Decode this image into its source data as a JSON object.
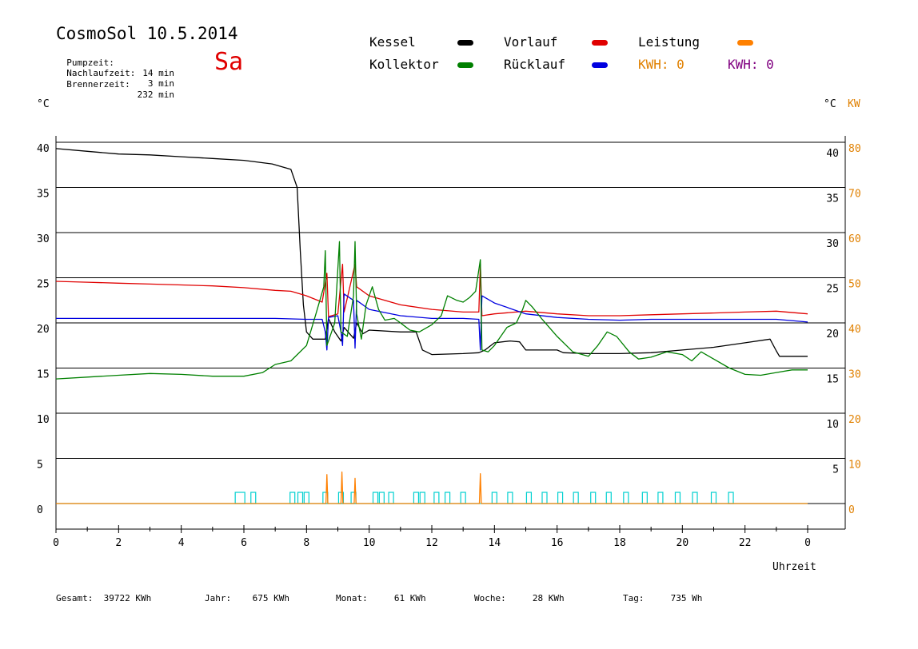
{
  "header": {
    "title": "CosmoSol 10.5.2014",
    "weekday": "Sa",
    "info": [
      {
        "label": "Pumpzeit:",
        "value": "14 min"
      },
      {
        "label": "Nachlaufzeit:",
        "value": "3 min"
      },
      {
        "label": "Brennerzeit:",
        "value": "232 min"
      }
    ]
  },
  "legend": {
    "items": [
      {
        "label": "Kessel",
        "color": "#000000"
      },
      {
        "label": "Kollektor",
        "color": "#008000"
      },
      {
        "label": "Vorlauf",
        "color": "#e00000"
      },
      {
        "label": "Rücklauf",
        "color": "#0000e0"
      },
      {
        "label": "Leistung",
        "color": "#ff8000"
      }
    ],
    "kwh": [
      {
        "text": "KWH: 0",
        "color": "#e08000"
      },
      {
        "text": "KWH: 0",
        "color": "#800080"
      }
    ]
  },
  "units": {
    "left": "°C",
    "right_c": "°C",
    "right_kw": "KW"
  },
  "footer": {
    "stats": [
      {
        "label": "Gesamt:",
        "value": "39722 KWh"
      },
      {
        "label": "Jahr:",
        "value": "675 KWh"
      },
      {
        "label": "Monat:",
        "value": "61 KWh"
      },
      {
        "label": "Woche:",
        "value": "28 KWh"
      },
      {
        "label": "Tag:",
        "value": "735 Wh"
      }
    ]
  },
  "chart_data": {
    "type": "line",
    "xlabel": "Uhrzeit",
    "x_ticks": [
      "0",
      "2",
      "4",
      "6",
      "8",
      "10",
      "12",
      "14",
      "16",
      "18",
      "20",
      "22",
      "0"
    ],
    "xlim": [
      0,
      24
    ],
    "y_left_ticks": [
      "0",
      "5",
      "10",
      "15",
      "20",
      "25",
      "30",
      "35",
      "40"
    ],
    "y_right_c_ticks": [
      "5",
      "10",
      "15",
      "20",
      "25",
      "30",
      "35",
      "40"
    ],
    "y_right_kw_ticks": [
      "0",
      "10",
      "20",
      "30",
      "40",
      "50",
      "60",
      "70",
      "80"
    ],
    "ylim": [
      0,
      40
    ],
    "grid": true,
    "series": [
      {
        "name": "Kessel",
        "color": "#000000",
        "points": [
          [
            0,
            39.3
          ],
          [
            1,
            39.0
          ],
          [
            2,
            38.7
          ],
          [
            3,
            38.6
          ],
          [
            4,
            38.4
          ],
          [
            5,
            38.2
          ],
          [
            6,
            38.0
          ],
          [
            6.9,
            37.6
          ],
          [
            7.2,
            37.3
          ],
          [
            7.5,
            37.0
          ],
          [
            7.7,
            35.0
          ],
          [
            7.8,
            28.0
          ],
          [
            7.9,
            22.0
          ],
          [
            8.0,
            19.0
          ],
          [
            8.2,
            18.2
          ],
          [
            8.6,
            18.2
          ],
          [
            8.7,
            20.5
          ],
          [
            8.9,
            19.0
          ],
          [
            9.1,
            18.0
          ],
          [
            9.2,
            19.5
          ],
          [
            9.5,
            18.3
          ],
          [
            9.6,
            20.0
          ],
          [
            9.8,
            18.8
          ],
          [
            10.0,
            19.2
          ],
          [
            11.0,
            19.0
          ],
          [
            11.5,
            19.0
          ],
          [
            11.7,
            17.0
          ],
          [
            12.0,
            16.5
          ],
          [
            13.0,
            16.6
          ],
          [
            13.5,
            16.7
          ],
          [
            13.7,
            17.0
          ],
          [
            14.0,
            17.8
          ],
          [
            14.5,
            18.0
          ],
          [
            14.8,
            17.9
          ],
          [
            15.0,
            17.0
          ],
          [
            16.0,
            17.0
          ],
          [
            16.2,
            16.7
          ],
          [
            17.0,
            16.6
          ],
          [
            18.0,
            16.6
          ],
          [
            19.0,
            16.7
          ],
          [
            20.0,
            17.0
          ],
          [
            21.0,
            17.3
          ],
          [
            22.0,
            17.8
          ],
          [
            22.8,
            18.2
          ],
          [
            23.0,
            16.9
          ],
          [
            23.1,
            16.3
          ],
          [
            24.0,
            16.3
          ]
        ]
      },
      {
        "name": "Vorlauf",
        "color": "#e00000",
        "points": [
          [
            0,
            24.6
          ],
          [
            1,
            24.5
          ],
          [
            2,
            24.4
          ],
          [
            3,
            24.3
          ],
          [
            4,
            24.2
          ],
          [
            5,
            24.1
          ],
          [
            6,
            23.9
          ],
          [
            7,
            23.6
          ],
          [
            7.5,
            23.5
          ],
          [
            8.0,
            23.0
          ],
          [
            8.5,
            22.3
          ],
          [
            8.65,
            25.5
          ],
          [
            8.7,
            20.7
          ],
          [
            9.0,
            21.0
          ],
          [
            9.15,
            26.5
          ],
          [
            9.2,
            21.2
          ],
          [
            9.55,
            26.5
          ],
          [
            9.6,
            24.0
          ],
          [
            10.0,
            23.0
          ],
          [
            11.0,
            22.0
          ],
          [
            12.0,
            21.5
          ],
          [
            13.0,
            21.2
          ],
          [
            13.5,
            21.2
          ],
          [
            13.55,
            26.5
          ],
          [
            13.6,
            20.8
          ],
          [
            14.0,
            21.0
          ],
          [
            15.0,
            21.3
          ],
          [
            16.0,
            21.0
          ],
          [
            17.0,
            20.8
          ],
          [
            18.0,
            20.8
          ],
          [
            19.0,
            20.9
          ],
          [
            20.0,
            21.0
          ],
          [
            21.0,
            21.1
          ],
          [
            22.0,
            21.2
          ],
          [
            23.0,
            21.3
          ],
          [
            24.0,
            21.0
          ]
        ]
      },
      {
        "name": "Rücklauf",
        "color": "#0000e0",
        "points": [
          [
            0,
            20.5
          ],
          [
            1,
            20.5
          ],
          [
            2,
            20.5
          ],
          [
            3,
            20.5
          ],
          [
            4,
            20.5
          ],
          [
            5,
            20.5
          ],
          [
            6,
            20.5
          ],
          [
            7,
            20.5
          ],
          [
            8,
            20.4
          ],
          [
            8.5,
            20.4
          ],
          [
            8.6,
            19.0
          ],
          [
            8.65,
            17.0
          ],
          [
            8.7,
            20.6
          ],
          [
            9.0,
            20.8
          ],
          [
            9.1,
            19.0
          ],
          [
            9.15,
            17.5
          ],
          [
            9.2,
            23.2
          ],
          [
            9.5,
            22.5
          ],
          [
            9.55,
            17.2
          ],
          [
            9.6,
            22.5
          ],
          [
            10.0,
            21.5
          ],
          [
            11.0,
            20.8
          ],
          [
            12.0,
            20.5
          ],
          [
            13.0,
            20.5
          ],
          [
            13.5,
            20.4
          ],
          [
            13.55,
            17.0
          ],
          [
            13.6,
            23.0
          ],
          [
            14.0,
            22.2
          ],
          [
            15.0,
            21.0
          ],
          [
            16.0,
            20.6
          ],
          [
            17.0,
            20.4
          ],
          [
            18.0,
            20.3
          ],
          [
            19.0,
            20.4
          ],
          [
            20.0,
            20.4
          ],
          [
            21.0,
            20.4
          ],
          [
            22.0,
            20.4
          ],
          [
            23.0,
            20.4
          ],
          [
            24.0,
            20.1
          ]
        ]
      },
      {
        "name": "Kollektor",
        "color": "#008000",
        "points": [
          [
            0,
            13.8
          ],
          [
            1,
            14.0
          ],
          [
            2,
            14.2
          ],
          [
            3,
            14.4
          ],
          [
            4,
            14.3
          ],
          [
            5,
            14.1
          ],
          [
            6,
            14.1
          ],
          [
            6.6,
            14.5
          ],
          [
            7.0,
            15.4
          ],
          [
            7.5,
            15.8
          ],
          [
            8.0,
            17.5
          ],
          [
            8.3,
            21.0
          ],
          [
            8.55,
            24.0
          ],
          [
            8.6,
            28.0
          ],
          [
            8.65,
            17.5
          ],
          [
            8.9,
            20.0
          ],
          [
            9.0,
            26.0
          ],
          [
            9.05,
            29.0
          ],
          [
            9.1,
            19.0
          ],
          [
            9.3,
            18.5
          ],
          [
            9.5,
            23.0
          ],
          [
            9.55,
            29.0
          ],
          [
            9.6,
            21.0
          ],
          [
            9.75,
            18.2
          ],
          [
            9.9,
            22.0
          ],
          [
            10.1,
            24.0
          ],
          [
            10.3,
            21.5
          ],
          [
            10.5,
            20.3
          ],
          [
            10.8,
            20.5
          ],
          [
            11.0,
            20.0
          ],
          [
            11.3,
            19.2
          ],
          [
            11.6,
            19.0
          ],
          [
            12.0,
            19.8
          ],
          [
            12.3,
            20.8
          ],
          [
            12.5,
            23.0
          ],
          [
            12.8,
            22.5
          ],
          [
            13.0,
            22.3
          ],
          [
            13.2,
            22.8
          ],
          [
            13.4,
            23.5
          ],
          [
            13.55,
            27.0
          ],
          [
            13.6,
            17.0
          ],
          [
            13.8,
            16.8
          ],
          [
            14.0,
            17.5
          ],
          [
            14.4,
            19.5
          ],
          [
            14.7,
            20.0
          ],
          [
            14.9,
            21.5
          ],
          [
            15.0,
            22.5
          ],
          [
            15.2,
            21.8
          ],
          [
            15.5,
            20.5
          ],
          [
            16.0,
            18.5
          ],
          [
            16.5,
            16.8
          ],
          [
            17.0,
            16.3
          ],
          [
            17.3,
            17.5
          ],
          [
            17.6,
            19.0
          ],
          [
            17.9,
            18.5
          ],
          [
            18.3,
            16.8
          ],
          [
            18.6,
            16.0
          ],
          [
            19.0,
            16.2
          ],
          [
            19.5,
            16.8
          ],
          [
            20.0,
            16.5
          ],
          [
            20.3,
            15.8
          ],
          [
            20.6,
            16.8
          ],
          [
            21.0,
            16.0
          ],
          [
            21.5,
            15.0
          ],
          [
            22.0,
            14.3
          ],
          [
            22.5,
            14.2
          ],
          [
            23.0,
            14.5
          ],
          [
            23.5,
            14.8
          ],
          [
            24.0,
            14.8
          ]
        ]
      },
      {
        "name": "Leistung",
        "color": "#ff8000",
        "points": [
          [
            0,
            0
          ],
          [
            8.62,
            0
          ],
          [
            8.65,
            3.2
          ],
          [
            8.68,
            0
          ],
          [
            9.1,
            0
          ],
          [
            9.13,
            3.5
          ],
          [
            9.16,
            0
          ],
          [
            9.52,
            0
          ],
          [
            9.55,
            2.8
          ],
          [
            9.58,
            0
          ],
          [
            13.52,
            0
          ],
          [
            13.55,
            3.3
          ],
          [
            13.58,
            0
          ],
          [
            24,
            0
          ]
        ]
      }
    ]
  }
}
